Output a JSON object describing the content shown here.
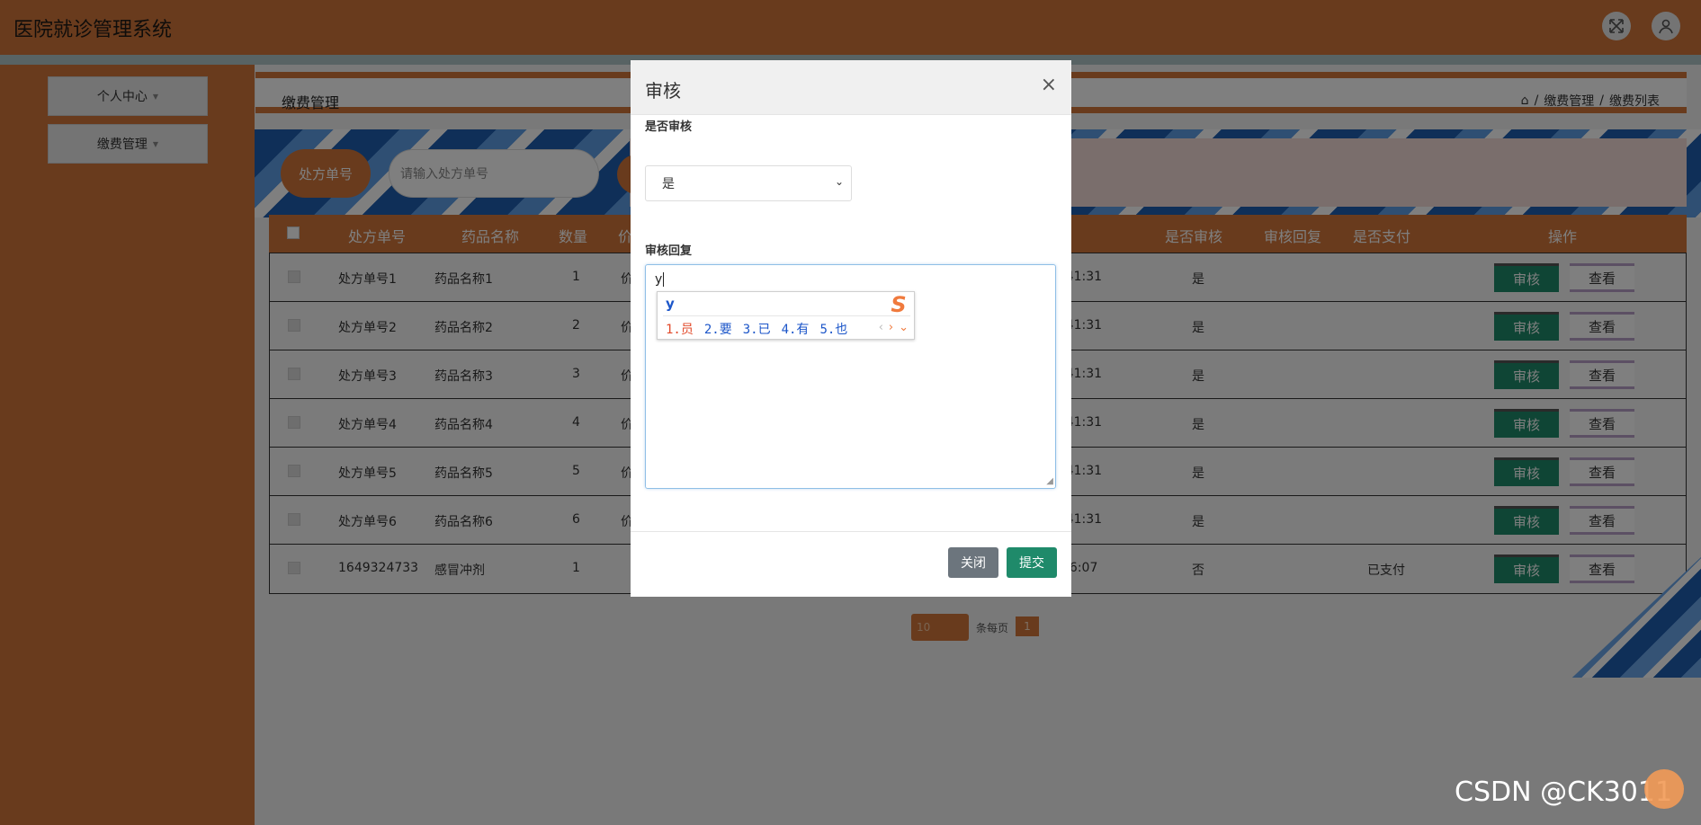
{
  "app": {
    "title": "医院就诊管理系统"
  },
  "topbar": {
    "icons": [
      "fullscreen-icon",
      "user-icon"
    ]
  },
  "sidebar": {
    "items": [
      {
        "label": "个人中心"
      },
      {
        "label": "缴费管理"
      }
    ]
  },
  "page": {
    "title": "缴费管理",
    "breadcrumb": [
      "缴费管理",
      "缴费列表"
    ],
    "search": {
      "label": "处方单号",
      "placeholder": "请输入处方单号"
    }
  },
  "table": {
    "headers": [
      "处方单号",
      "药品名称",
      "数量",
      "价",
      "是否审核",
      "审核回复",
      "是否支付",
      "操作"
    ],
    "rows": [
      {
        "no": "处方单号1",
        "drug": "药品名称1",
        "qty": "1",
        "price": "价",
        "time": ":41:31",
        "audited": "是",
        "reply": "",
        "paid": ""
      },
      {
        "no": "处方单号2",
        "drug": "药品名称2",
        "qty": "2",
        "price": "价",
        "time": ":41:31",
        "audited": "是",
        "reply": "",
        "paid": ""
      },
      {
        "no": "处方单号3",
        "drug": "药品名称3",
        "qty": "3",
        "price": "价",
        "time": ":41:31",
        "audited": "是",
        "reply": "",
        "paid": ""
      },
      {
        "no": "处方单号4",
        "drug": "药品名称4",
        "qty": "4",
        "price": "价",
        "time": ":41:31",
        "audited": "是",
        "reply": "",
        "paid": ""
      },
      {
        "no": "处方单号5",
        "drug": "药品名称5",
        "qty": "5",
        "price": "价",
        "time": ":41:31",
        "audited": "是",
        "reply": "",
        "paid": ""
      },
      {
        "no": "处方单号6",
        "drug": "药品名称6",
        "qty": "6",
        "price": "价",
        "time": ":41:31",
        "audited": "是",
        "reply": "",
        "paid": ""
      },
      {
        "no": "1649324733",
        "drug": "感冒冲剂",
        "qty": "1",
        "price": "",
        "time": "46:07",
        "audited": "否",
        "reply": "",
        "paid": "已支付"
      }
    ],
    "actions": {
      "audit": "审核",
      "view": "查看"
    }
  },
  "pager": {
    "page_size": "10",
    "per_page_label": "条每页",
    "current_page": "1"
  },
  "modal": {
    "title": "审核",
    "close_symbol": "×",
    "audit_label": "是否审核",
    "audit_value": "是",
    "reply_label": "审核回复",
    "reply_value": "y",
    "close_button": "关闭",
    "submit_button": "提交"
  },
  "ime": {
    "input": "y",
    "candidates": [
      "1.员",
      "2.要",
      "3.已",
      "4.有",
      "5.也"
    ],
    "logo": "S"
  },
  "watermark": "CSDN @CK3011",
  "colors": {
    "brand": "#d2773a",
    "accent_green": "#1f8a6a",
    "overlay": "rgba(0,0,0,0.5)"
  }
}
